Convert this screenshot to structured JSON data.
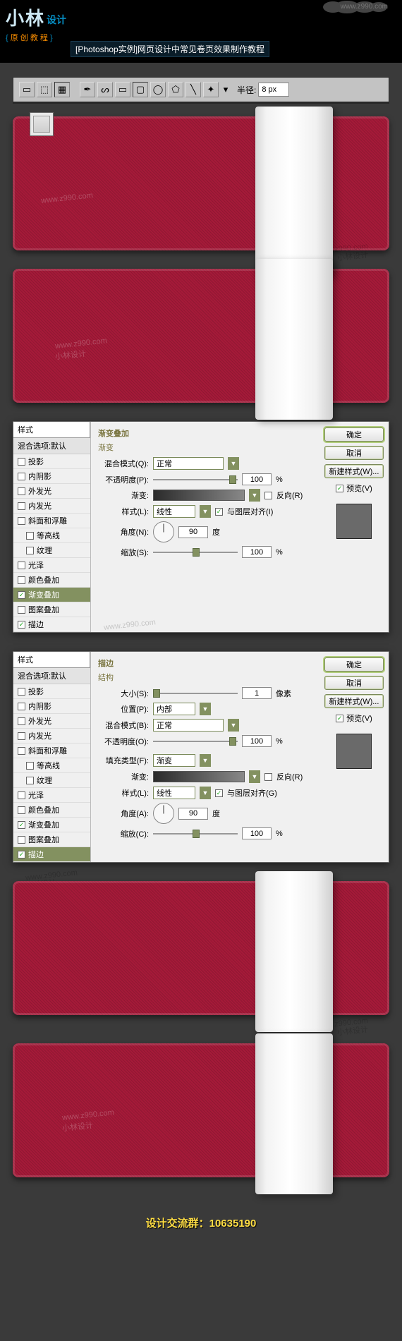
{
  "header": {
    "url_top": "www.z990.com",
    "logo_main": "小林",
    "logo_sub": "设计",
    "tagline_open": "{",
    "tagline": "原 创 教 程",
    "tagline_close": "}",
    "page_title": "[Photoshop实例]网页设计中常见卷页效果制作教程"
  },
  "toolbar": {
    "radius_label": "半径:",
    "radius_value": "8 px"
  },
  "watermarks": {
    "url": "www.z990.com",
    "brand": "小林设计"
  },
  "dialog1": {
    "styles_title": "样式",
    "blend_header": "混合选项:默认",
    "items": [
      {
        "label": "投影",
        "checked": false
      },
      {
        "label": "内阴影",
        "checked": false
      },
      {
        "label": "外发光",
        "checked": false
      },
      {
        "label": "内发光",
        "checked": false
      },
      {
        "label": "斜面和浮雕",
        "checked": false
      },
      {
        "label": "等高线",
        "checked": false,
        "indent": true
      },
      {
        "label": "纹理",
        "checked": false,
        "indent": true
      },
      {
        "label": "光泽",
        "checked": false
      },
      {
        "label": "颜色叠加",
        "checked": false
      },
      {
        "label": "渐变叠加",
        "checked": true,
        "active": true
      },
      {
        "label": "图案叠加",
        "checked": false
      },
      {
        "label": "描边",
        "checked": true
      }
    ],
    "panel_title": "渐变叠加",
    "sub_title": "渐变",
    "blend_mode_label": "混合模式(Q):",
    "blend_mode_value": "正常",
    "opacity_label": "不透明度(P):",
    "opacity_value": "100",
    "opacity_unit": "%",
    "gradient_label": "渐变:",
    "reverse_label": "反向(R)",
    "style_label": "样式(L):",
    "style_value": "线性",
    "align_label": "与图层对齐(I)",
    "align_checked": true,
    "angle_label": "角度(N):",
    "angle_value": "90",
    "angle_unit": "度",
    "scale_label": "缩放(S):",
    "scale_value": "100",
    "scale_unit": "%",
    "buttons": {
      "ok": "确定",
      "cancel": "取消",
      "new_style": "新建样式(W)...",
      "preview": "预览(V)"
    }
  },
  "dialog2": {
    "styles_title": "样式",
    "blend_header": "混合选项:默认",
    "items": [
      {
        "label": "投影",
        "checked": false
      },
      {
        "label": "内阴影",
        "checked": false
      },
      {
        "label": "外发光",
        "checked": false
      },
      {
        "label": "内发光",
        "checked": false
      },
      {
        "label": "斜面和浮雕",
        "checked": false
      },
      {
        "label": "等高线",
        "checked": false,
        "indent": true
      },
      {
        "label": "纹理",
        "checked": false,
        "indent": true
      },
      {
        "label": "光泽",
        "checked": false
      },
      {
        "label": "颜色叠加",
        "checked": false
      },
      {
        "label": "渐变叠加",
        "checked": true
      },
      {
        "label": "图案叠加",
        "checked": false
      },
      {
        "label": "描边",
        "checked": true,
        "active": true
      }
    ],
    "panel_title": "描边",
    "sub_title": "结构",
    "size_label": "大小(S):",
    "size_value": "1",
    "size_unit": "像素",
    "position_label": "位置(P):",
    "position_value": "内部",
    "blend_mode_label": "混合模式(B):",
    "blend_mode_value": "正常",
    "opacity_label": "不透明度(O):",
    "opacity_value": "100",
    "opacity_unit": "%",
    "fill_type_label": "填充类型(F):",
    "fill_type_value": "渐变",
    "gradient_label": "渐变:",
    "reverse_label": "反向(R)",
    "style_label": "样式(L):",
    "style_value": "线性",
    "align_label": "与图层对齐(G)",
    "align_checked": true,
    "angle_label": "角度(A):",
    "angle_value": "90",
    "angle_unit": "度",
    "scale_label": "缩放(C):",
    "scale_value": "100",
    "scale_unit": "%",
    "buttons": {
      "ok": "确定",
      "cancel": "取消",
      "new_style": "新建样式(W)...",
      "preview": "预览(V)"
    }
  },
  "footer": {
    "text": "设计交流群：10635190"
  }
}
